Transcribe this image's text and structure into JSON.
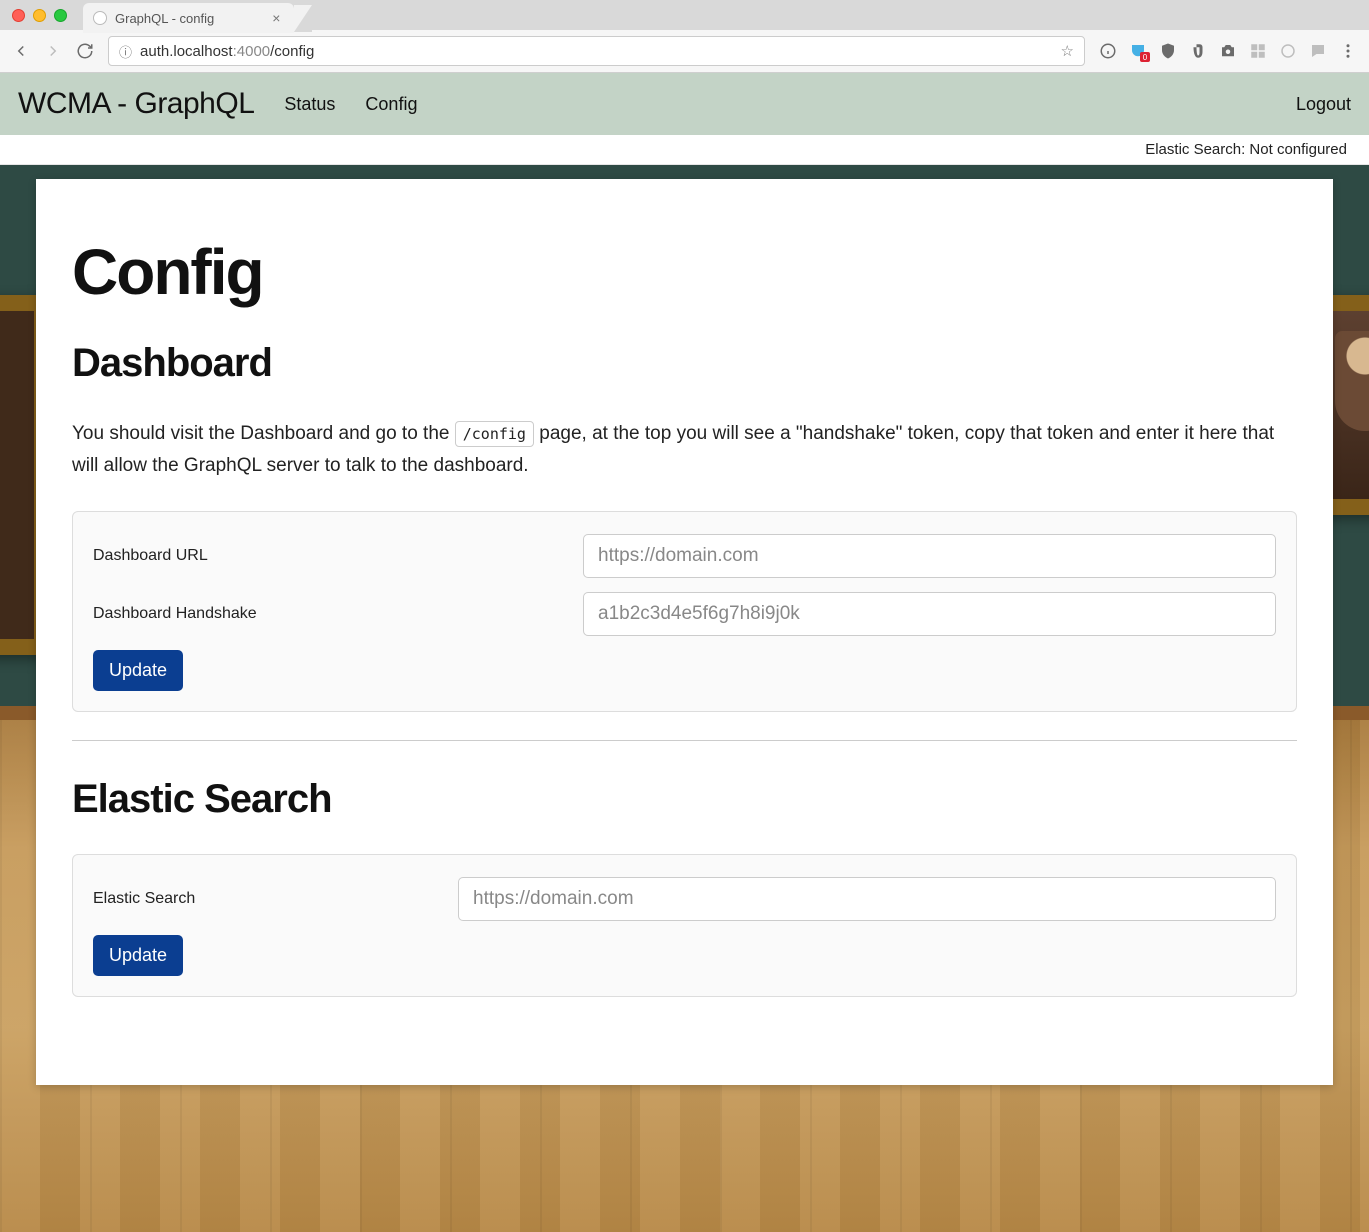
{
  "browser": {
    "tab_title": "GraphQL - config",
    "url": {
      "host": "auth.localhost",
      "port": ":4000",
      "path": "/config"
    }
  },
  "header": {
    "title": "WCMA - GraphQL",
    "nav": [
      "Status",
      "Config"
    ],
    "logout": "Logout"
  },
  "status_strip": "Elastic Search: Not configured",
  "page": {
    "title": "Config",
    "dashboard": {
      "heading": "Dashboard",
      "intro_pre": "You should visit the Dashboard and go to the ",
      "intro_code": "/config",
      "intro_post": " page, at the top you will see a \"handshake\" token, copy that token and enter it here that will allow the GraphQL server to talk to the dashboard.",
      "url_label": "Dashboard URL",
      "url_placeholder": "https://domain.com",
      "handshake_label": "Dashboard Handshake",
      "handshake_placeholder": "a1b2c3d4e5f6g7h8i9j0k",
      "update": "Update"
    },
    "elastic": {
      "heading": "Elastic Search",
      "label": "Elastic Search",
      "placeholder": "https://domain.com",
      "update": "Update"
    }
  }
}
